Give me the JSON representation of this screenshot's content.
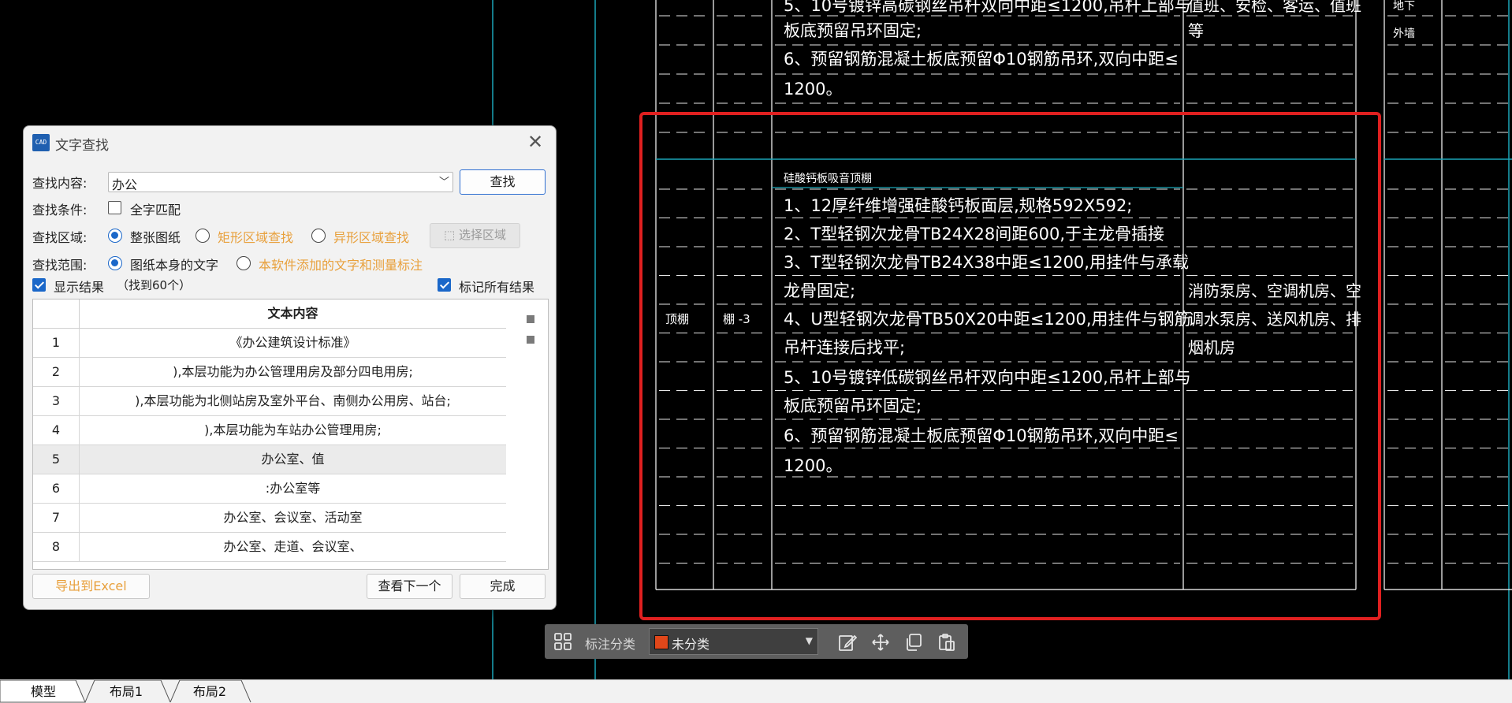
{
  "drawing": {
    "top_item5_lines": [
      "5、10号镀锌高碳钢丝吊杆双向中距≤1200,吊杆上部与",
      "板底预留吊环固定;"
    ],
    "top_item6_lines": [
      "6、预留钢筋混凝土板底预留Φ10钢筋吊环,双向中距≤",
      "1200。"
    ],
    "top_col4_lines": [
      "值班、安检、客运、值班",
      "等"
    ],
    "top_col5_lines": [
      "地下",
      "外墙"
    ],
    "row_title": "硅酸钙板吸音顶棚",
    "row_col1": "顶棚",
    "row_col2": "棚 -3",
    "row_lines": [
      "1、12厚纤维增强硅酸钙板面层,规格592X592;",
      "2、T型轻钢次龙骨TB24X28间距600,于主龙骨插接",
      "3、T型轻钢次龙骨TB24X38中距≤1200,用挂件与承载",
      "龙骨固定;",
      "4、U型轻钢次龙骨TB50X20中距≤1200,用挂件与钢筋",
      "吊杆连接后找平;",
      "5、10号镀锌低碳钢丝吊杆双向中距≤1200,吊杆上部与",
      "板底预留吊环固定;",
      "6、预留钢筋混凝土板底预留Φ10钢筋吊环,双向中距≤",
      "1200。"
    ],
    "row_col4_lines": [
      "消防泵房、空调机房、空",
      "调水泵房、送风机房、排",
      "烟机房"
    ],
    "highlight_color": "#e02020"
  },
  "dialog": {
    "title": "文字查找",
    "logo_text": "CAD",
    "close_icon": "✕",
    "search_label": "查找内容:",
    "search_value": "办公",
    "find_button": "查找",
    "condition_label": "查找条件:",
    "whole_word": "全字匹配",
    "area_label": "查找区域:",
    "area_options": [
      "整张图纸",
      "矩形区域查找",
      "异形区域查找"
    ],
    "select_area_button": "选择区域",
    "scope_label": "查找范围:",
    "scope_options": [
      "图纸本身的文字",
      "本软件添加的文字和测量标注"
    ],
    "show_results": "显示结果",
    "found_count": "（找到60个）",
    "mark_all": "标记所有结果",
    "table_header": "文本内容",
    "rows": [
      {
        "n": "1",
        "text": "《办公建筑设计标准》"
      },
      {
        "n": "2",
        "text": "),本层功能为办公管理用房及部分四电用房;"
      },
      {
        "n": "3",
        "text": "),本层功能为北侧站房及室外平台、南侧办公用房、站台;"
      },
      {
        "n": "4",
        "text": "),本层功能为车站办公管理用房;"
      },
      {
        "n": "5",
        "text": "办公室、值"
      },
      {
        "n": "6",
        "text": ":办公室等"
      },
      {
        "n": "7",
        "text": "办公室、会议室、活动室"
      },
      {
        "n": "8",
        "text": "办公室、走道、会议室、"
      }
    ],
    "export_button": "导出到Excel",
    "next_button": "查看下一个",
    "done_button": "完成"
  },
  "toolbar": {
    "label": "标注分类",
    "category": "未分类",
    "swatch_color": "#e0471a",
    "icons": [
      "grid-icon",
      "edit-icon",
      "move-icon",
      "copy-icon",
      "paste-icon"
    ]
  },
  "tabs": [
    "模型",
    "布局1",
    "布局2"
  ]
}
